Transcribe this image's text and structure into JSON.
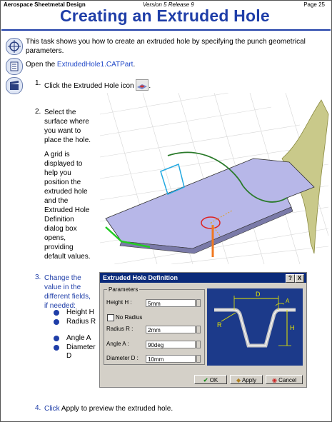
{
  "header": {
    "left": "Aerospace Sheetmetal Design",
    "center": "Version 5 Release 9",
    "right": "Page 25"
  },
  "title": "Creating an Extruded Hole",
  "intro": "This task shows you how to create an extruded hole by specifying the punch geometrical parameters.",
  "open": {
    "prefix": "Open the ",
    "link": "ExtrudedHole1.CATPart",
    "suffix": "."
  },
  "steps": {
    "s1": {
      "num": "1.",
      "text": "Click the Extruded Hole icon",
      "end": "."
    },
    "s2": {
      "num": "2.",
      "p1": [
        "Select the",
        "surface where",
        "you want to",
        "place the hole."
      ],
      "p2": [
        "A grid  is",
        "displayed to",
        "help you",
        "position the",
        "extruded hole",
        "and the",
        "Extruded Hole",
        "Definition",
        "dialog box",
        "opens,",
        "providing",
        "default values."
      ]
    },
    "s3": {
      "num": "3.",
      "lines": [
        "Change the",
        "value in the",
        "different fields,",
        "if needed:"
      ],
      "bullets": [
        "Height H",
        "Radius R",
        "Angle A",
        "Diameter D"
      ]
    },
    "s4": {
      "num": "4.",
      "click": "Click",
      "text": " Apply to preview the extruded hole."
    }
  },
  "dialog": {
    "title": "Extruded Hole Definition",
    "help": "?",
    "close": "X",
    "group": "Parameters",
    "height_label": "Height H :",
    "height_value": "5mm",
    "no_radius": "No Radius",
    "radius_label": "Radius R :",
    "radius_value": "2mm",
    "angle_label": "Angle A :",
    "angle_value": "90deg",
    "diameter_label": "Diameter D :",
    "diameter_value": "10mm",
    "ok": "OK",
    "apply": "Apply",
    "cancel": "Cancel",
    "diagram_labels": {
      "d": "D",
      "a": "A",
      "h": "H",
      "r": "R"
    }
  },
  "colors": {
    "title": "#1f3ea8",
    "link": "#2048c8",
    "dialog_title": "#0a2a7a",
    "diagram_bg": "#1c3a8a"
  }
}
